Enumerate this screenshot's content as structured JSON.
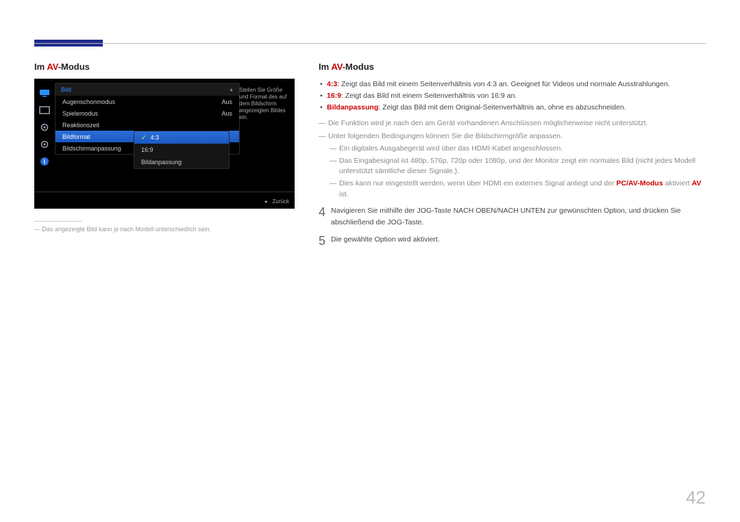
{
  "page_number": "42",
  "left": {
    "heading_pre": "Im ",
    "heading_accent": "AV",
    "heading_post": "-Modus",
    "footnote": "Das angezeigte Bild kann je nach Modell unterschiedlich sein."
  },
  "osd": {
    "header": "Bild",
    "items": [
      {
        "label": "Augenschonmodus",
        "value": "Aus"
      },
      {
        "label": "Spielemodus",
        "value": "Aus"
      },
      {
        "label": "Reaktionszeit",
        "value": ""
      },
      {
        "label": "Bildformat",
        "value": ""
      },
      {
        "label": "Bildschirmanpassung",
        "value": ""
      }
    ],
    "submenu": [
      {
        "label": "4:3",
        "checked": true
      },
      {
        "label": "16:9",
        "checked": false
      },
      {
        "label": "Bildanpassung",
        "checked": false
      }
    ],
    "desc": "Stellen Sie Größe und Format des auf dem Bildschirm angezeigten Bildes ein.",
    "back_label": "Zurück"
  },
  "right": {
    "heading_pre": "Im ",
    "heading_accent": "AV",
    "heading_post": "-Modus",
    "bullets": [
      {
        "label": "4:3",
        "text": ": Zeigt das Bild mit einem Seitenverhältnis von 4:3 an. Geeignet für Videos und normale Ausstrahlungen."
      },
      {
        "label": "16:9",
        "text": ": Zeigt das Bild mit einem Seitenverhältnis von 16:9 an."
      },
      {
        "label": "Bildanpassung",
        "text": ": Zeigt das Bild mit dem Original-Seitenverhältnis an, ohne es abzuschneiden."
      }
    ],
    "notes": {
      "n1": "Die Funktion wird je nach den am Gerät vorhandenen Anschlüssen möglicherweise nicht unterstützt.",
      "n2": "Unter folgenden Bedingungen können Sie die Bildschirmgröße anpassen.",
      "n2a": "Ein digitales Ausgabegerät wird über das HDMI-Kabel angeschlossen.",
      "n2b": "Das Eingabesignal ist 480p, 576p, 720p oder 1080p, und der Monitor zeigt ein normales Bild (nicht jedes Modell unterstützt sämtliche dieser Signale.).",
      "n2c_pre": "Dies kann nur eingestellt werden, wenn über HDMI ein externes Signal anliegt und der ",
      "n2c_hl1": "PC/AV-Modus",
      "n2c_mid": " aktiviert ",
      "n2c_hl2": "AV",
      "n2c_post": " ist."
    },
    "steps": {
      "s4": "Navigieren Sie mithilfe der JOG-Taste NACH OBEN/NACH UNTEN zur gewünschten Option, und drücken Sie abschließend die JOG-Taste.",
      "s5": "Die gewählte Option wird aktiviert."
    }
  }
}
